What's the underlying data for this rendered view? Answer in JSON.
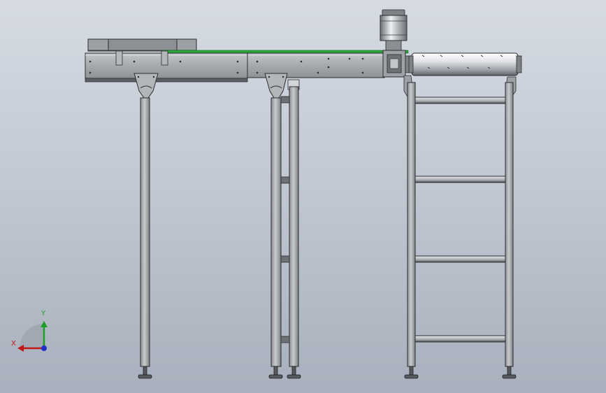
{
  "view": {
    "background_top": "#d6dbe3",
    "background_bottom": "#a8b0bd",
    "frame_color": "#a9acaf",
    "frame_shadow": "#6e7174",
    "edge_color": "#2b2d30",
    "belt_color": "#2aa63a"
  },
  "triad": {
    "y_label": "Y",
    "x_label": "X",
    "y_color": "#1e9e28",
    "x_color": "#c01818",
    "z_color": "#2030c8"
  },
  "model": {
    "parts": [
      "conveyor-frame",
      "belt",
      "drive-motor",
      "gearbox",
      "roller-drum",
      "support-legs",
      "cross-braces",
      "leveling-feet"
    ]
  }
}
